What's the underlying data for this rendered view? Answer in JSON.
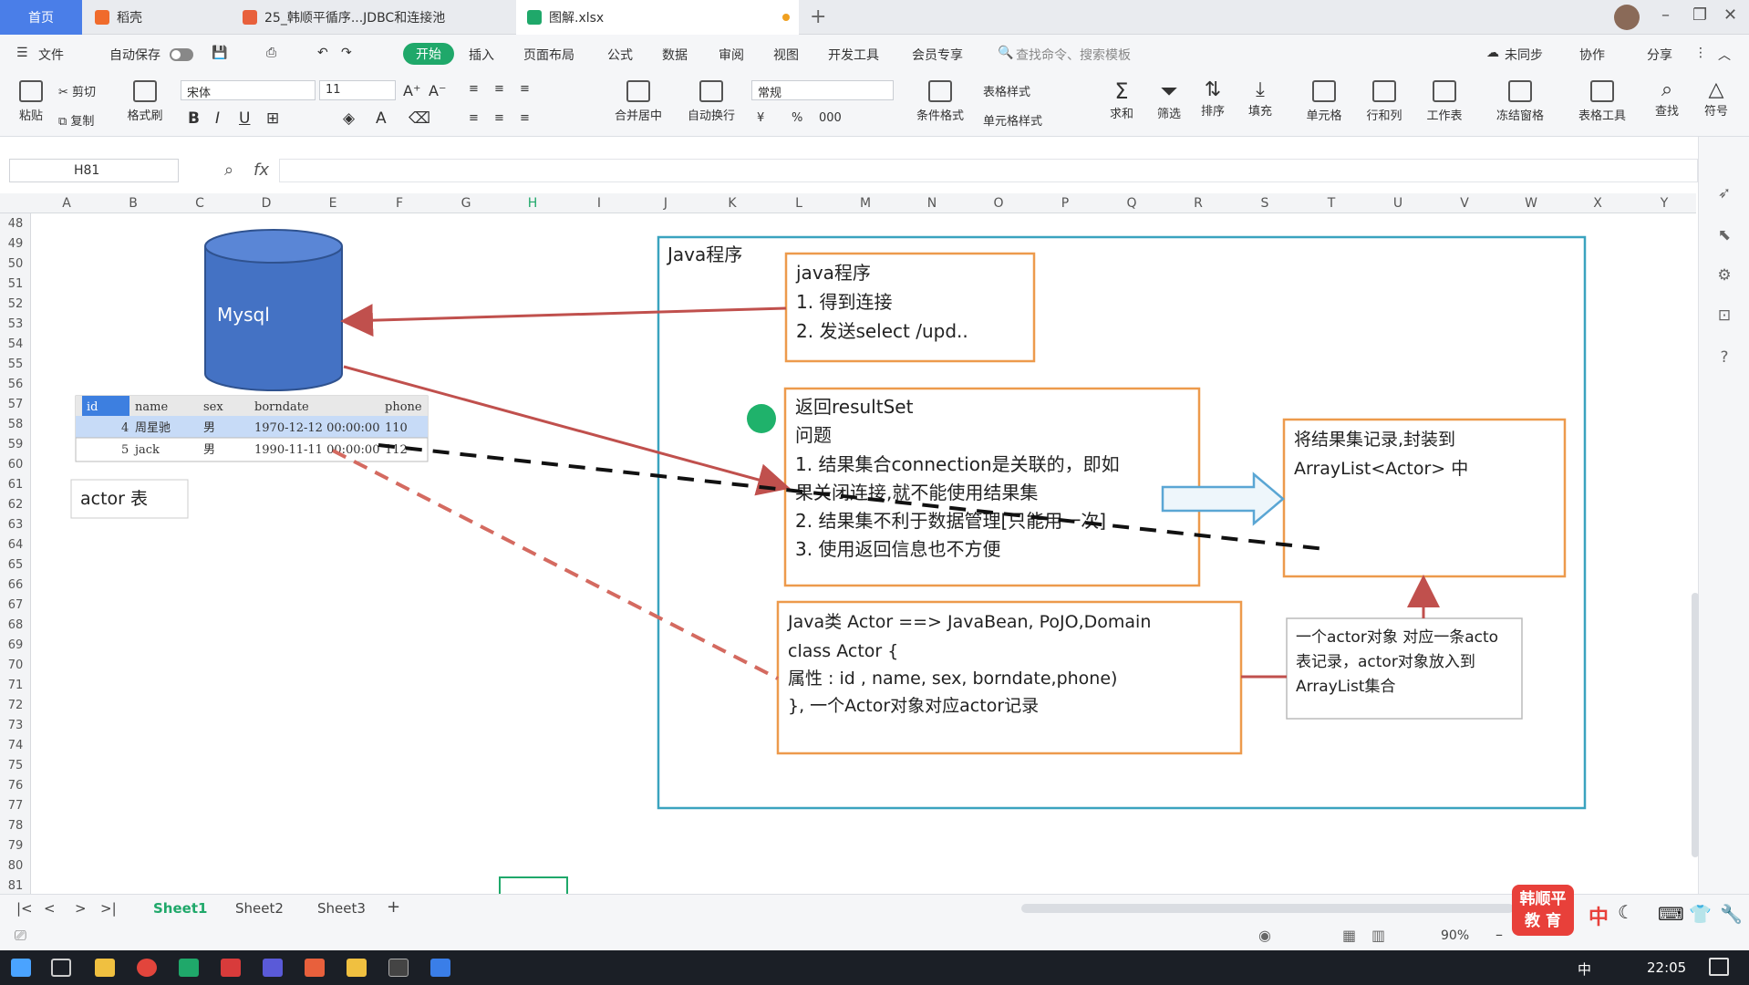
{
  "tabs": {
    "home": "首页",
    "t1": "稻壳",
    "t2": "25_韩顺平循序...JDBC和连接池",
    "t3": "图解.xlsx"
  },
  "menu": {
    "file": "文件",
    "autosave": "自动保存",
    "start": "开始",
    "insert": "插入",
    "layout": "页面布局",
    "formula": "公式",
    "data": "数据",
    "review": "审阅",
    "view": "视图",
    "dev": "开发工具",
    "member": "会员专享",
    "search": "查找命令、搜索模板",
    "unsync": "未同步",
    "collab": "协作",
    "share": "分享"
  },
  "ribbon": {
    "paste": "粘贴",
    "cut": "剪切",
    "copy": "复制",
    "format_painter": "格式刷",
    "font": "宋体",
    "size": "11",
    "merge": "合并居中",
    "wrap": "自动换行",
    "numfmt": "常规",
    "cond": "条件格式",
    "table_style": "表格样式",
    "cell_style": "单元格样式",
    "sum": "求和",
    "filter": "筛选",
    "sort": "排序",
    "fill": "填充",
    "cell": "单元格",
    "rowcol": "行和列",
    "sheet": "工作表",
    "freeze": "冻结窗格",
    "tabletools": "表格工具",
    "find": "查找",
    "symbol": "符号"
  },
  "formula_bar": {
    "cell_ref": "H81",
    "fx": "fx"
  },
  "columns": [
    "A",
    "B",
    "C",
    "D",
    "E",
    "F",
    "G",
    "H",
    "I",
    "J",
    "K",
    "L",
    "M",
    "N",
    "O",
    "P",
    "Q",
    "R",
    "S",
    "T",
    "U",
    "V",
    "W",
    "X",
    "Y"
  ],
  "rows": [
    "48",
    "49",
    "50",
    "51",
    "52",
    "53",
    "54",
    "55",
    "56",
    "57",
    "58",
    "59",
    "60",
    "61",
    "62",
    "63",
    "64",
    "65",
    "66",
    "67",
    "68",
    "69",
    "70",
    "71",
    "72",
    "73",
    "74",
    "75",
    "76",
    "77",
    "78",
    "79",
    "80",
    "81"
  ],
  "diagram": {
    "db_label": "Mysql",
    "table": {
      "headers": [
        "id",
        "name",
        "sex",
        "borndate",
        "phone"
      ],
      "rows": [
        [
          "4",
          "周星驰",
          "男",
          "1970-12-12 00:00:00",
          "110"
        ],
        [
          "5",
          "jack",
          "男",
          "1990-11-11 00:00:00",
          "112"
        ]
      ]
    },
    "actor_label": "actor 表",
    "frame_title": "Java程序",
    "box1": [
      "java程序",
      "1. 得到连接",
      "2. 发送select /upd.."
    ],
    "box2": [
      "返回resultSet",
      "问题",
      "1. 结果集合connection是关联的，即如",
      "果关闭连接,就不能使用结果集",
      "2. 结果集不利于数据管理[只能用一次]",
      "3. 使用返回信息也不方便"
    ],
    "box3": [
      "Java类 Actor  ==> JavaBean, PoJO,Domain",
      "class Actor {",
      "属性 : id , name, sex, borndate,phone)",
      "}, 一个Actor对象对应actor记录"
    ],
    "box4": [
      "将结果集记录,封装到",
      "ArrayList<Actor> 中"
    ],
    "box5": [
      "一个actor对象 对应一条acto",
      "表记录，actor对象放入到",
      "ArrayList集合"
    ]
  },
  "sheets": [
    "Sheet1",
    "Sheet2",
    "Sheet3"
  ],
  "status": {
    "zoom": "90%"
  },
  "logo": {
    "line1": "韩顺平",
    "line2": "教 育"
  },
  "taskbar": {
    "clock": "22:05",
    "ime": "中"
  },
  "colors": {
    "accent": "#1fa86a",
    "db_blue": "#4472c4",
    "box_orange": "#ed9a4c",
    "frame_teal": "#3aa3bf",
    "arrow_red": "#c0504d"
  }
}
